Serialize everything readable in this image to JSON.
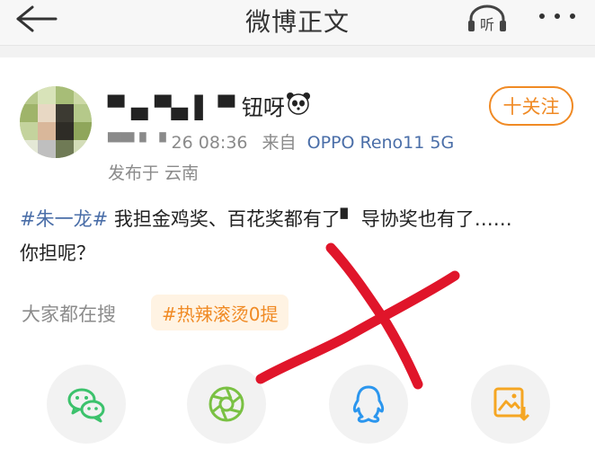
{
  "header": {
    "title": "微博正文",
    "listen_label": "听"
  },
  "post": {
    "username": "▀ ▄ ▀▄ ▌ ▀ 钮呀",
    "follow_label": "十关注",
    "date": "▀▀ ▘▝ 26 08:36",
    "source_prefix": "来自",
    "source_device": "OPPO Reno11 5G",
    "location": "发布于 云南",
    "hashtag": "#朱一龙#",
    "text_line1": " 我担金鸡奖、百花奖都有了▘ 导协奖也有了……",
    "text_line2": "你担呢？"
  },
  "search": {
    "label": "大家都在搜",
    "hot_topic": "#热辣滚烫0提"
  },
  "colors": {
    "accent_orange": "#f08a24",
    "link_blue": "#4a6ea8",
    "wechat_green": "#3cc26c",
    "moments_green": "#7ac143",
    "qq_blue": "#2b96ee",
    "save_orange": "#f5a623",
    "annotation_red": "#e0152a"
  },
  "share_icons": [
    "wechat-icon",
    "moments-icon",
    "qq-icon",
    "save-image-icon"
  ]
}
